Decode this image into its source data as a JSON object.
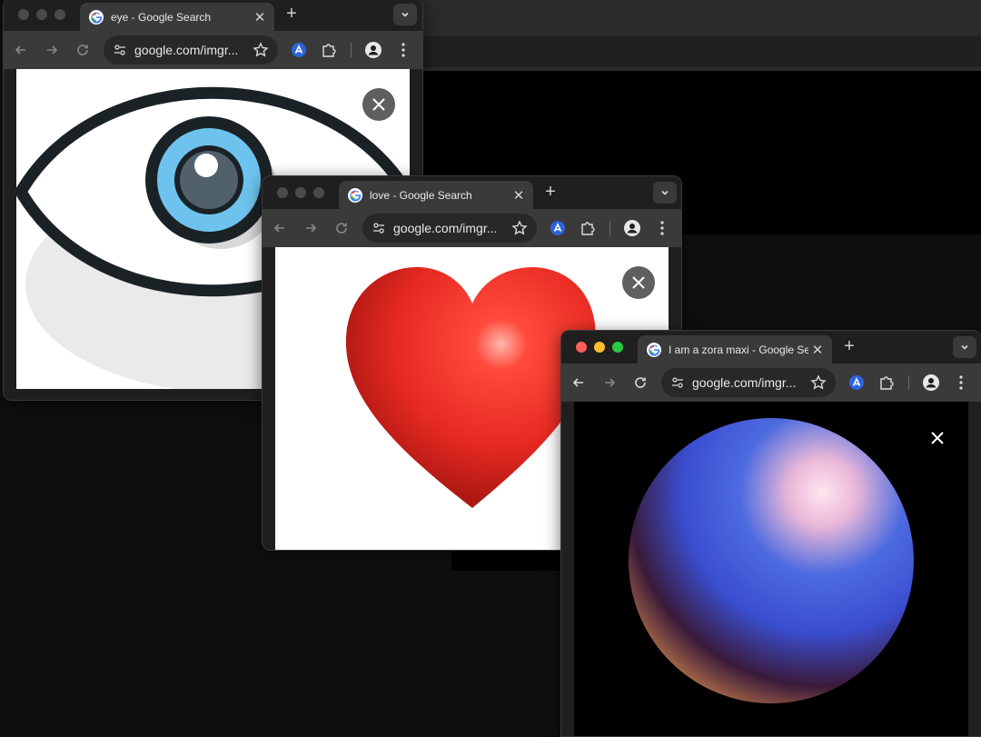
{
  "windows": [
    {
      "tab_title": "eye - Google Search",
      "url": "google.com/imgr...",
      "image_subject": "eye"
    },
    {
      "tab_title": "love - Google Search",
      "url": "google.com/imgr...",
      "image_subject": "red heart"
    },
    {
      "tab_title": "I am a zora maxi - Google Search",
      "url": "google.com/imgr...",
      "image_subject": "gradient sphere"
    }
  ],
  "colors": {
    "eye_iris": "#6ec3ee",
    "heart": "#e62a22",
    "sphere_blue": "#4d6be0",
    "sphere_orange": "#c9814a"
  },
  "icons": [
    "back-arrow-icon",
    "forward-arrow-icon",
    "reload-icon",
    "site-settings-icon",
    "star-icon",
    "profile-extension-icon",
    "puzzle-icon",
    "account-icon",
    "more-vert-icon",
    "close-icon",
    "chevron-down-icon",
    "plus-icon",
    "google-favicon"
  ]
}
